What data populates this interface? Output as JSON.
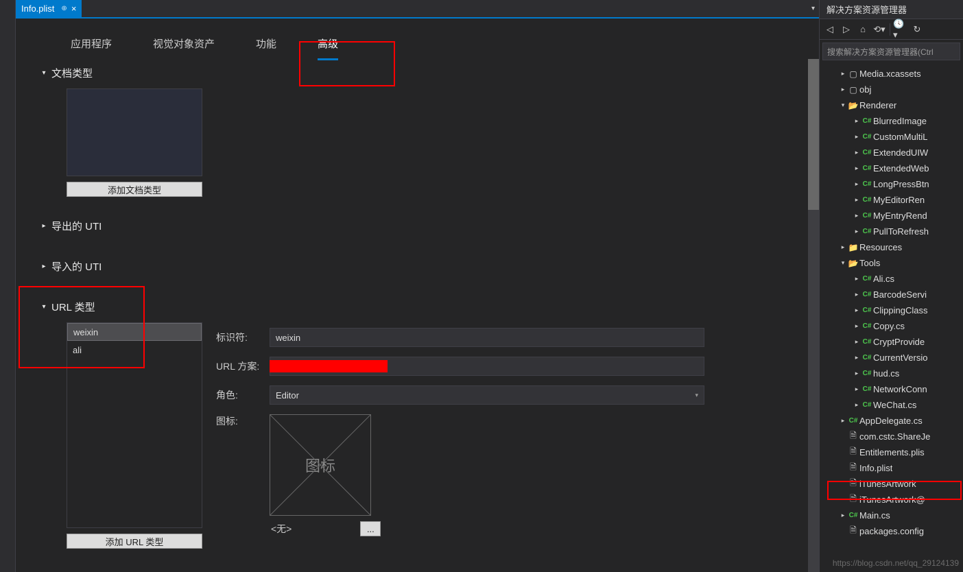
{
  "tab": {
    "title": "Info.plist"
  },
  "subtabs": {
    "t0": "应用程序",
    "t1": "视觉对象资产",
    "t2": "功能",
    "t3": "高级"
  },
  "sections": {
    "docType": "文档类型",
    "addDocType": "添加文档类型",
    "exportedUTI": "导出的 UTI",
    "importedUTI": "导入的 UTI",
    "urlTypes": "URL 类型",
    "addUrlType": "添加 URL 类型"
  },
  "urlList": {
    "i0": "weixin",
    "i1": "ali"
  },
  "form": {
    "identifierLabel": "标识符:",
    "identifier": "weixin",
    "schemeLabel": "URL 方案:",
    "roleLabel": "角色:",
    "role": "Editor",
    "iconLabel": "图标:",
    "iconPlaceholder": "图标",
    "noneLabel": "<无>",
    "browse": "..."
  },
  "explorer": {
    "title": "解决方案资源管理器",
    "searchPlaceholder": "搜索解决方案资源管理器(Ctrl",
    "nodes": {
      "n0": "Media.xcassets",
      "n1": "obj",
      "n2": "Renderer",
      "n3": "BlurredImage",
      "n4": "CustomMultiL",
      "n5": "ExtendedUIW",
      "n6": "ExtendedWeb",
      "n7": "LongPressBtn",
      "n8": "MyEditorRen",
      "n9": "MyEntryRend",
      "n10": "PullToRefresh",
      "n11": "Resources",
      "n12": "Tools",
      "n13": "Ali.cs",
      "n14": "BarcodeServi",
      "n15": "ClippingClass",
      "n16": "Copy.cs",
      "n17": "CryptProvide",
      "n18": "CurrentVersio",
      "n19": "hud.cs",
      "n20": "NetworkConn",
      "n21": "WeChat.cs",
      "n22": "AppDelegate.cs",
      "n23": "com.cstc.ShareJe",
      "n24": "Entitlements.plis",
      "n25": "Info.plist",
      "n26": "iTunesArtwork",
      "n27": "iTunesArtwork@",
      "n28": "Main.cs",
      "n29": "packages.config"
    }
  },
  "watermark": "https://blog.csdn.net/qq_29124139"
}
